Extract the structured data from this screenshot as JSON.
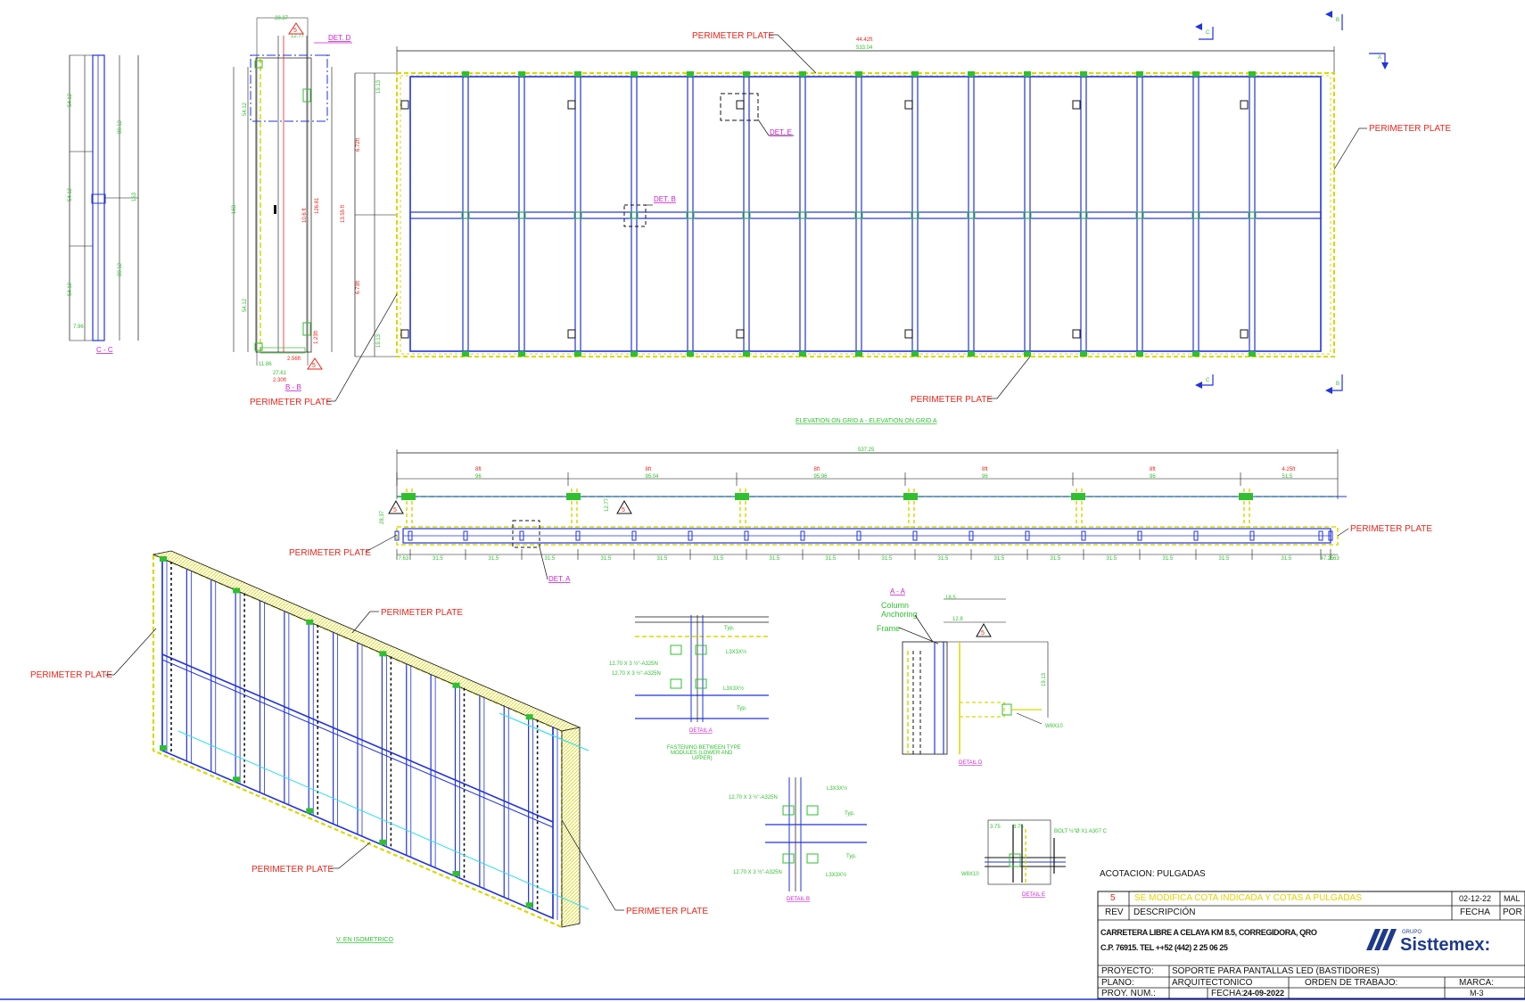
{
  "labels": {
    "perimeter_plate": "PERIMETER PLATE",
    "det_a": "DET. A",
    "det_b": "DET. B",
    "det_d": "DET. D",
    "det_e": "DET. E",
    "section_cc": "C - C",
    "section_bb": "B - B",
    "section_aa": "A - A",
    "elevation_title": "ELEVATION ON GRID A - ELEVATION ON GRID A",
    "isometric_title": "V. EN ISOMETRICO",
    "detail_a": "DETAIL A",
    "detail_b": "DETAIL B",
    "detail_d": "DETAIL D",
    "detail_e": "DETAIL E",
    "fastening_note_1": "FASTENING BETWEEN TYPE",
    "fastening_note_2": "MODULES (LOWER AND",
    "fastening_note_3": "UPPER)",
    "column_anchoring_1": "Column",
    "column_anchoring_2": "Anchoring",
    "frame": "Frame",
    "w8x10": "W8X10",
    "marker_a": "A",
    "marker_b": "B",
    "marker_c": "C",
    "rev_triangle": "5"
  },
  "dimensions": {
    "top_overall_ft": "44.42ft",
    "top_overall_in": "533.04",
    "plan_overall": "537.25",
    "bay_ft": [
      "8ft",
      "8ft",
      "8ft",
      "8ft",
      "8ft",
      "4.25ft"
    ],
    "bay_in": [
      "96",
      "95.04",
      "95.96",
      "96",
      "96",
      "51.5"
    ],
    "spacing": [
      "7.63",
      "31.5",
      "31.5",
      "31.5",
      "31.5",
      "31.5",
      "31.5",
      "31.5",
      "31.5",
      "31.5",
      "31.5",
      "31.5",
      "31.5",
      "31.5",
      "31.5",
      "31.5",
      "31.5",
      "47.25",
      "7.63"
    ],
    "height_ft_1": "6.72ft",
    "height_ft_2": "6.73ft",
    "height_ft_total": "13.55 ft",
    "side_a": "10.6 ft",
    "side_b": "2.56ft",
    "side_c": "2.30ft",
    "side_d": "28.37"
  },
  "notes": {
    "acotacion": "ACOTACION: PULGADAS"
  },
  "title_block": {
    "rev_number": "5",
    "rev_description": "SE MODIFICA COTA INDICADA Y COTAS A PULGADAS",
    "rev_date": "02-12-22",
    "rev_by": "MAL",
    "rev_header": "REV",
    "desc_header": "DESCRIPCIÓN",
    "fecha_header": "FECHA",
    "por_header": "POR",
    "address_line_1": "CARRETERA LIBRE A CELAYA KM 8.5, CORREGIDORA, QRO",
    "address_line_2": "C.P. 76915. TEL ++52 (442) 2 25 06 25",
    "logo_grupo": "GRUPO",
    "logo_name": "Sisttemex:",
    "proyecto_label": "PROYECTO:",
    "proyecto_value": "SOPORTE PARA PANTALLAS LED (BASTIDORES)",
    "plano_label": "PLANO:",
    "plano_value": "ARQUITECTONICO",
    "orden_label": "ORDEN DE TRABAJO:",
    "marca_label": "MARCA:",
    "marca_value": "M-3",
    "proy_num_label": "PROY. NUM.:",
    "fecha_label": "FECHA:",
    "fecha_value": "24-09-2022"
  },
  "colors": {
    "frame_blue": "#2233dd",
    "dim_green": "#2fbf2f",
    "label_red": "#e8251b",
    "detail_magenta": "#cc22cc",
    "plate_yellow": "#d8d800",
    "rev_yellow": "#e6d200"
  }
}
